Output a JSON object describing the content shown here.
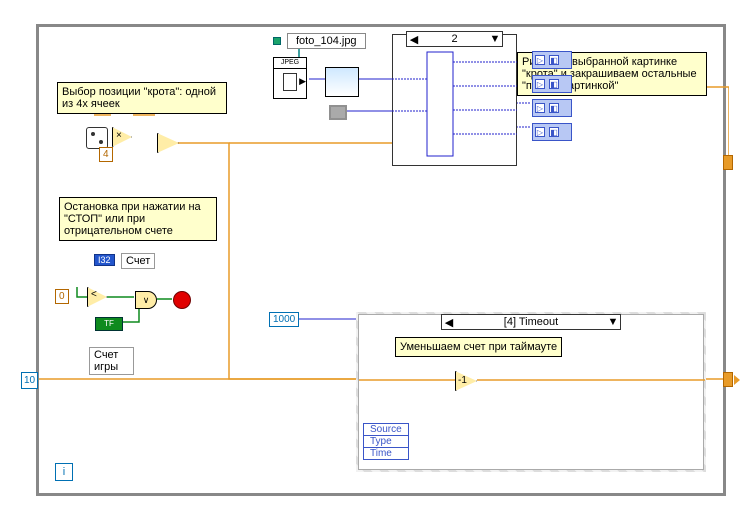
{
  "loop": {
    "init_const": "10",
    "i_terminal": "i"
  },
  "comments": {
    "pos": "Выбор позиции \"крота\": одной из 4х ячеек",
    "stop": "Остановка при нажатии на \"СТОП\" или при отрицательном счете",
    "draw": "Рисуем в выбранной картинке \"крота\" и закрашиваем остальные \"пустой картинкой\"",
    "timeout_dec": "Уменьшаем счет при таймауте"
  },
  "consts": {
    "four": "4",
    "zero": "0",
    "thousand": "1000"
  },
  "labels": {
    "score_ctrl": "Счет",
    "score_game": "Счет игры",
    "bool": "TF"
  },
  "mul": "×",
  "lt": "<",
  "or": "∨",
  "decr": "-1",
  "i32": "I32",
  "file": {
    "name": "foto_104.jpg",
    "jpeg": "JPEG"
  },
  "case": {
    "left_arrow": "◀",
    "right_arrow": "▼",
    "value": "2"
  },
  "event": {
    "left_arrow": "◀",
    "right_arrow": "▼",
    "value": "[4] Timeout",
    "fields": [
      "Source",
      "Type",
      "Time"
    ]
  },
  "pic_glyph": "▷"
}
